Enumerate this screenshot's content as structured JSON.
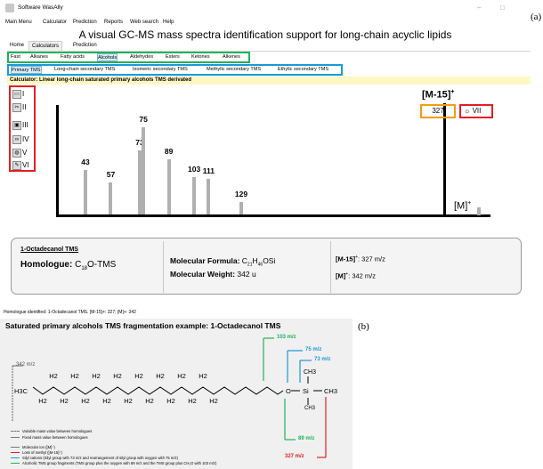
{
  "window": {
    "title": "Software WasAlly",
    "minimize": "–",
    "maximize": "□",
    "close": "✕"
  },
  "menu": [
    "Main Menu",
    "Calculator",
    "Prediction",
    "Reports",
    "Web search",
    "Help"
  ],
  "headline": "A visual GC-MS mass spectra identification support for long-chain acyclic lipids",
  "main_tabs": [
    "Home",
    "Calculators",
    "Prediction"
  ],
  "compound_tabs": [
    "Fast",
    "Alkanes",
    "Fatty acids",
    "Alcohols",
    "Aldehydes",
    "Esters",
    "Ketones",
    "Alkenes"
  ],
  "sub_tabs": [
    "Primary TMS",
    "Long-chain secondary TMS",
    "Isomeric secondary TMS",
    "Methylic secondary TMS",
    "Ethylic secondary TMS"
  ],
  "calculator_label": "Calculator: Linear long-chain saturated primary alcohols TMS derivated",
  "tools": [
    {
      "icon": "speech-bubble-icon",
      "label": "I"
    },
    {
      "icon": "scissors-icon",
      "label": "II"
    },
    {
      "icon": "save-icon",
      "label": "III"
    },
    {
      "icon": "molecule-icon",
      "label": "IV"
    },
    {
      "icon": "globe-icon",
      "label": "V"
    },
    {
      "icon": "brush-icon",
      "label": "VI"
    }
  ],
  "spectrum": {
    "peaks": [
      {
        "label": "43",
        "mz": 43,
        "rel": 0.42
      },
      {
        "label": "57",
        "mz": 57,
        "rel": 0.3
      },
      {
        "label": "73",
        "mz": 73,
        "rel": 0.6
      },
      {
        "label": "75",
        "mz": 75,
        "rel": 0.82
      },
      {
        "label": "89",
        "mz": 89,
        "rel": 0.52
      },
      {
        "label": "103",
        "mz": 103,
        "rel": 0.35
      },
      {
        "label": "111",
        "mz": 111,
        "rel": 0.33
      },
      {
        "label": "129",
        "mz": 129,
        "rel": 0.12
      }
    ]
  },
  "m15_label": "[M-15]",
  "m15_sup": "+",
  "m15_value": "327",
  "vii_label": "VII",
  "m_label": "[M]",
  "m_sup": "+",
  "compound": {
    "name": "1-Octadecanol TMS",
    "homologue_label": "Homologue:",
    "homologue_c": "C",
    "homologue_n": "18",
    "homologue_rest": "O-TMS",
    "formula_label": "Molecular Formula:",
    "formula_parts": [
      "C",
      "21",
      "H",
      "46",
      "OSi"
    ],
    "weight_label": "Molecular Weight:",
    "weight_value": "342 u",
    "m15_line": "[M-15]",
    "m15_line_sup": "+",
    "m15_line_val": ": 327 m/z",
    "m_line": "[M]",
    "m_line_sup": "+",
    "m_line_val": ": 342 m/z"
  },
  "status": "Homologue identified: 1-Octadecanol TMS. [M-15]+: 327; [M]+: 342",
  "fig_label_a": "(a)",
  "fig_label_b": "(b)",
  "frag": {
    "title": "Saturated primary alcohols TMS fragmentation example: 1-Octadecanol TMS",
    "mz_342": "342 m/z",
    "mz_103": "103 m/z",
    "mz_75": "75 m/z",
    "mz_73": "73 m/z",
    "mz_89": "89 m/z",
    "mz_327": "327 m/z",
    "h3c": "H3C",
    "ch3": "CH3",
    "si": "Si",
    "o": "O",
    "h2": "H2",
    "h3": "H3",
    "legend": [
      "Variable mass value between homologues",
      "Fixed mass value between homologues",
      "Molecular ion ([M]⁺)",
      "Loss of methyl ([M-15]⁺)",
      "Silyl cations (Silyl group with 73 m/z and rearrangement of silyl group with oxygen with 75 m/z)",
      "Alcoholic TMS group fragments (TMS group plus the oxygen with 89 m/z and the TMS group plus CH₂O with 103 m/z)"
    ]
  },
  "colors": {
    "green": "#1fb25a",
    "blue": "#1a9ad9",
    "red": "#e31e24",
    "orange": "#f39c12",
    "yellow": "#fff8c4",
    "bar": "#b0b0b0"
  }
}
